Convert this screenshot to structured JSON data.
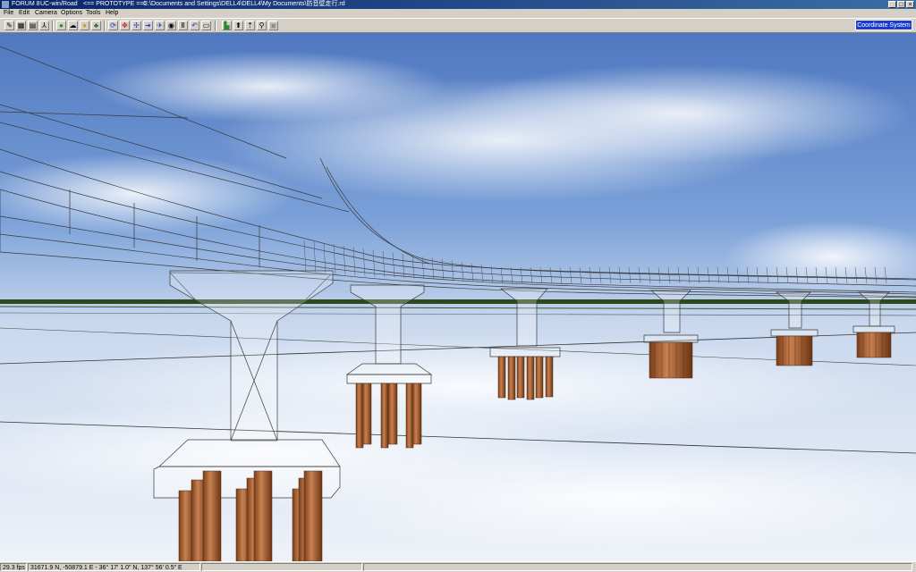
{
  "window": {
    "title_app": "FORUM 8",
    "title_product": "UC-win/Road",
    "title_mode": "<== PROTOTYPE ==>",
    "title_path": "C:\\Documents and Settings\\DELL4\\DELL4\\My Documents\\防音壁走行.rd",
    "controls": [
      "_",
      "□",
      "×"
    ]
  },
  "menu": [
    "File",
    "Edit",
    "Camera",
    "Options",
    "Tools",
    "Help"
  ],
  "toolbar": {
    "coordinate_system_label": "Coordinate System 8",
    "icons": [
      "pencil-icon",
      "terrain-icon",
      "road-icon",
      "person-icon",
      "globe-icon",
      "cloud-icon",
      "light-icon",
      "tree-icon",
      "rotate-icon",
      "pan-icon",
      "move-icon",
      "walk-icon",
      "fly-icon",
      "camera-icon",
      "pause-icon",
      "back-icon",
      "minus-icon",
      "car-icon",
      "up-icon",
      "up-alt-icon",
      "run-icon",
      "save-icon"
    ]
  },
  "status": {
    "fps": "29.3 fps",
    "coords": "31671.9 N, -50879.1 E  -  36° 17' 1.0\" N, 137° 56' 0.5\" E",
    "field3": "",
    "field4": ""
  },
  "colors": {
    "title_left": "#0a246a",
    "title_right": "#3a6ea5",
    "coord_button": "#1a3cd0",
    "sky_top": "#5b80c4",
    "pile": "#b06a3a"
  }
}
